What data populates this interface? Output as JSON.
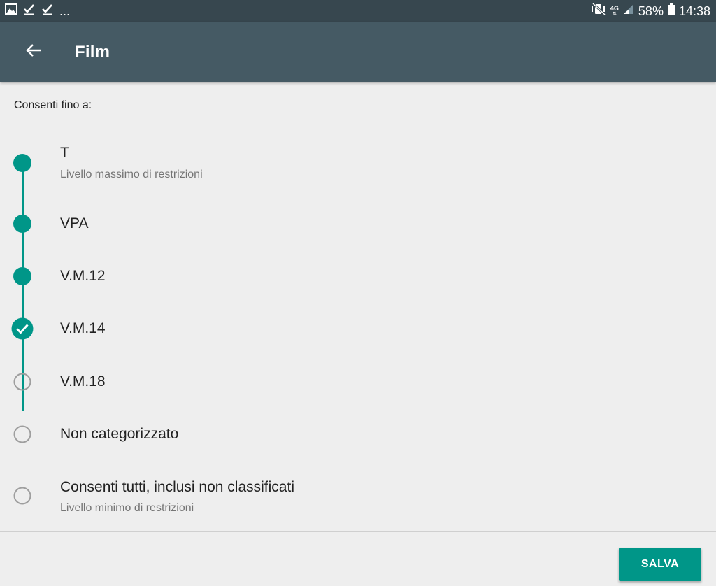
{
  "status_bar": {
    "left_icons": [
      "image-icon",
      "check-icon",
      "check-icon"
    ],
    "more_indicator": "...",
    "network_label": "4G",
    "battery_percent": "58%",
    "time": "14:38"
  },
  "app_bar": {
    "back_icon": "arrow-back-icon",
    "title": "Film"
  },
  "intro_label": "Consenti fino a:",
  "options": [
    {
      "title": "T",
      "subtitle": "Livello massimo di restrizioni",
      "state": "included"
    },
    {
      "title": "VPA",
      "subtitle": "",
      "state": "included"
    },
    {
      "title": "V.M.12",
      "subtitle": "",
      "state": "included"
    },
    {
      "title": "V.M.14",
      "subtitle": "",
      "state": "selected"
    },
    {
      "title": "V.M.18",
      "subtitle": "",
      "state": "unselected"
    },
    {
      "title": "Non categorizzato",
      "subtitle": "",
      "state": "unselected"
    },
    {
      "title": "Consenti tutti, inclusi non classificati",
      "subtitle": "Livello minimo di restrizioni",
      "state": "unselected"
    }
  ],
  "save_button": {
    "label": "SALVA"
  },
  "colors": {
    "status_bar": "#37474f",
    "app_bar": "#455a64",
    "accent": "#009688",
    "background": "#eeeeee",
    "unselected_ring": "#9e9e9e"
  }
}
